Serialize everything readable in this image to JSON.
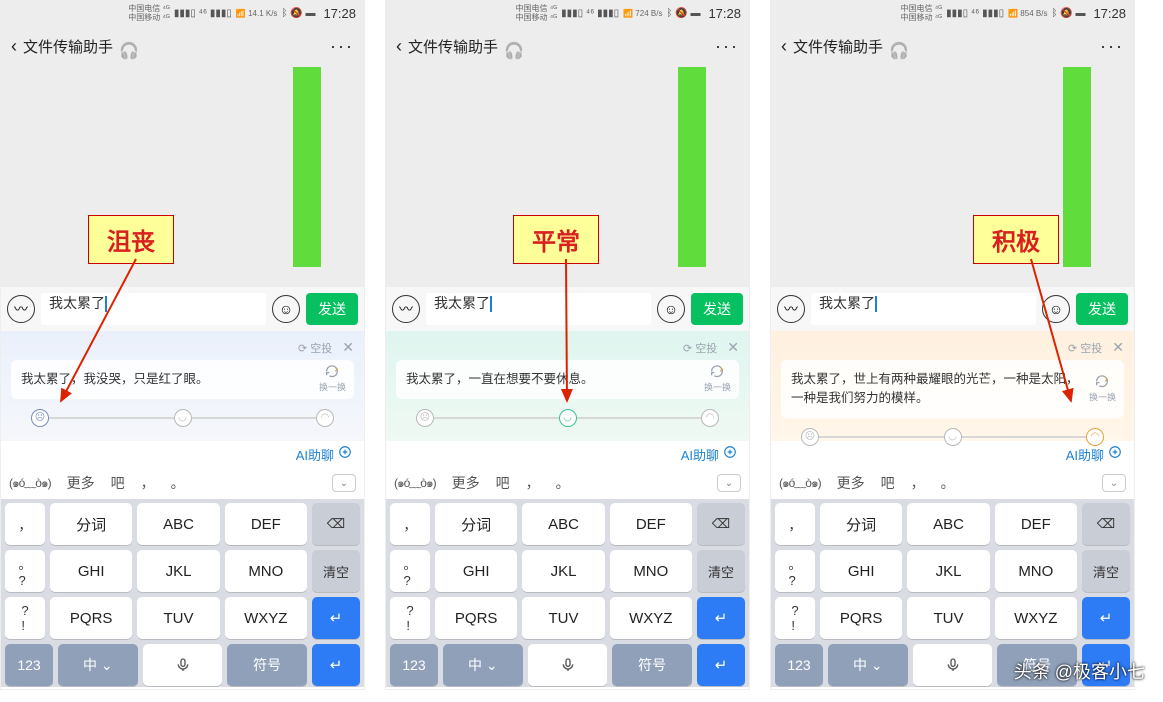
{
  "screens": [
    {
      "mood_label": "沮丧",
      "ai_suggestion": "我太累了，我没哭，只是红了眼。",
      "panel_class": "p0",
      "active_face": 0
    },
    {
      "mood_label": "平常",
      "ai_suggestion": "我太累了，一直在想要不要休息。",
      "panel_class": "p1",
      "active_face": 1
    },
    {
      "mood_label": "积极",
      "ai_suggestion": "我太累了，世上有两种最耀眼的光芒，一种是太阳，一种是我们努力的模样。",
      "panel_class": "p2",
      "active_face": 2
    }
  ],
  "shared": {
    "status": {
      "carrier1": "中国电信 ⁴ᴳ",
      "carrier2": "中国移动 ⁴ᴳ",
      "wifi_txt": "14.1 K/s",
      "wifi_txt1": "724 B/s",
      "wifi_txt2": "854 B/s",
      "bt_icon": "⚡",
      "time": "17:28"
    },
    "title": "文件传输助手",
    "input_text": "我太累了",
    "send_label": "发送",
    "ai_top_label": "⟳ 空投",
    "refresh_label": "换一换",
    "ai_link": "AI助聊",
    "suggestions": {
      "kaomoji": "(๑ó﹏ò๑)",
      "more": "更多",
      "s1": "吧",
      "s2": "，",
      "s3": "。"
    },
    "keyboard": {
      "row1_punct": [
        "，",
        "。"
      ],
      "row1": [
        "分词",
        "ABC",
        "DEF"
      ],
      "row2_punct": [
        "。",
        "?"
      ],
      "row2": [
        "GHI",
        "JKL",
        "MNO"
      ],
      "row3_punct": [
        "?",
        "!"
      ],
      "row3": [
        "PQRS",
        "TUV",
        "WXYZ"
      ],
      "bksp": "⌫",
      "clear": "清空",
      "enter": "↵",
      "num": "123",
      "lang": "中 ⌄",
      "sym": "符号"
    }
  },
  "watermark": "头条 @极客小七"
}
